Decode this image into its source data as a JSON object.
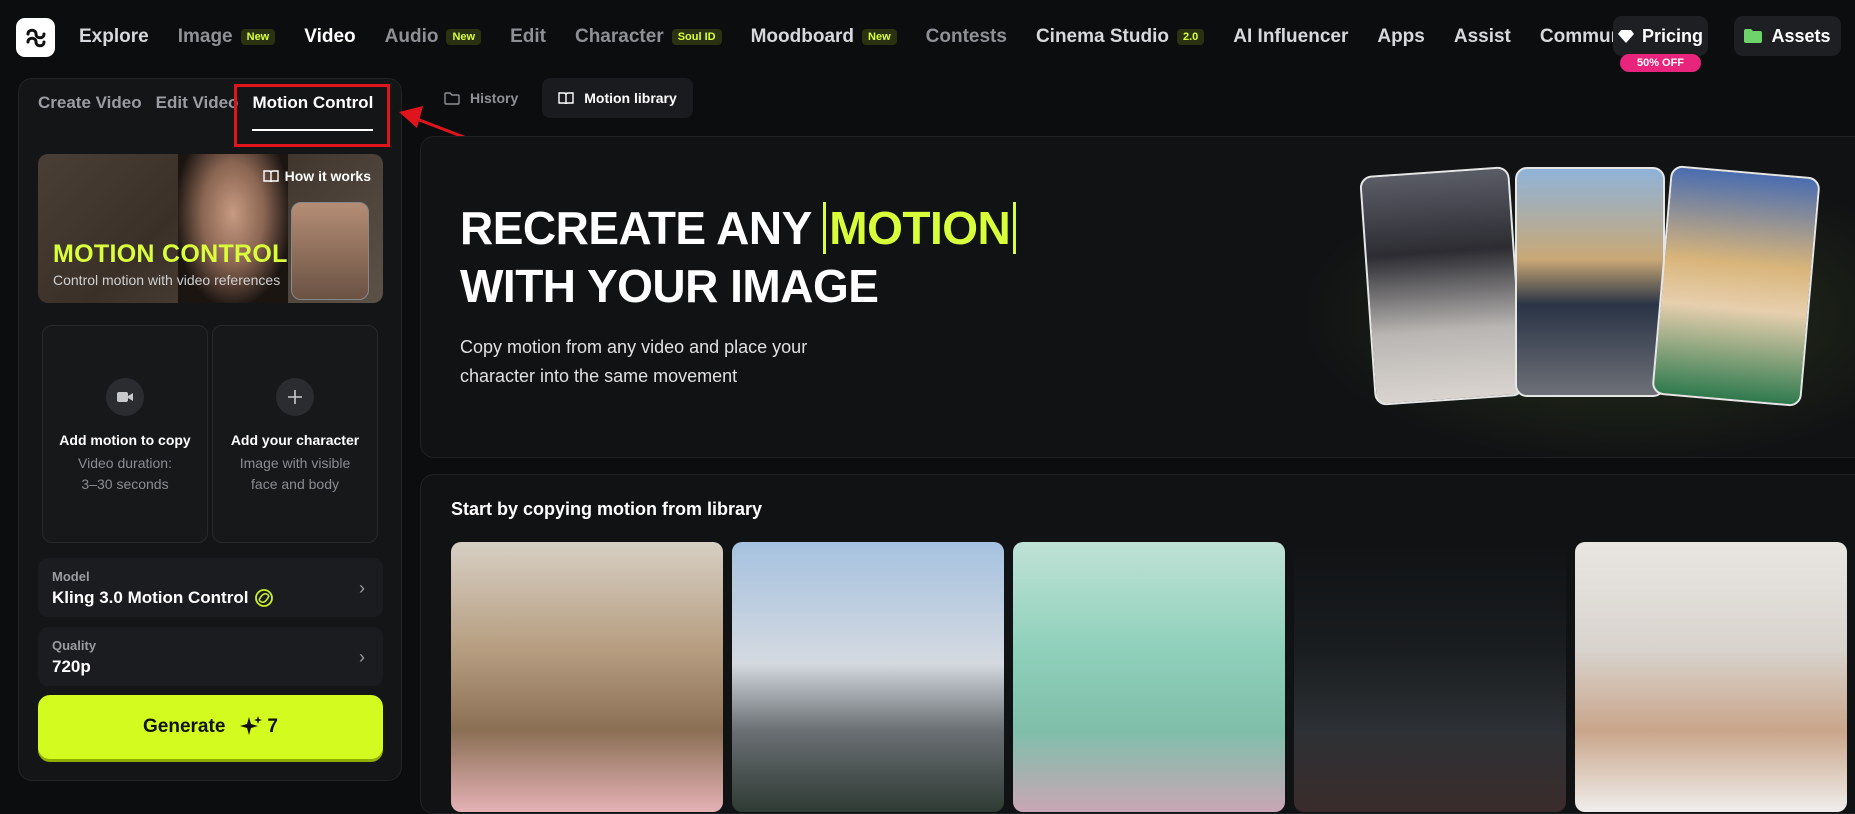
{
  "nav": {
    "items": [
      {
        "label": "Explore",
        "badge": ""
      },
      {
        "label": "Image",
        "badge": "New"
      },
      {
        "label": "Video",
        "badge": ""
      },
      {
        "label": "Audio",
        "badge": "New"
      },
      {
        "label": "Edit",
        "badge": ""
      },
      {
        "label": "Character",
        "badge": "Soul ID"
      },
      {
        "label": "Moodboard",
        "badge": "New"
      },
      {
        "label": "Contests",
        "badge": ""
      },
      {
        "label": "Cinema Studio",
        "badge": "2.0"
      },
      {
        "label": "AI Influencer",
        "badge": ""
      },
      {
        "label": "Apps",
        "badge": ""
      },
      {
        "label": "Assist",
        "badge": ""
      },
      {
        "label": "Community",
        "badge": ""
      }
    ],
    "pricing_label": "Pricing",
    "sale_badge": "50% OFF",
    "assets_label": "Assets"
  },
  "sidebar": {
    "tabs": [
      "Create Video",
      "Edit Video",
      "Motion Control"
    ],
    "hero": {
      "how_it_works": "How it works",
      "title": "MOTION CONTROL",
      "subtitle": "Control motion with video references"
    },
    "upload_motion": {
      "title": "Add motion to copy",
      "line1": "Video duration:",
      "line2": "3–30 seconds"
    },
    "upload_character": {
      "title": "Add your character",
      "line1": "Image with visible",
      "line2": "face and body"
    },
    "model": {
      "label": "Model",
      "value": "Kling 3.0 Motion Control"
    },
    "quality": {
      "label": "Quality",
      "value": "720p"
    },
    "generate": {
      "label": "Generate",
      "cost": "7"
    }
  },
  "subtabs": [
    "History",
    "Motion library"
  ],
  "banner": {
    "line1_pre": "RECREATE ANY ",
    "line1_highlight": "MOTION",
    "line2": "WITH YOUR IMAGE",
    "desc_line1": "Copy motion from any video and place your",
    "desc_line2": "character into the same movement"
  },
  "library": {
    "title": "Start by copying motion from library"
  },
  "colors": {
    "accent": "#d9ff3a",
    "generate": "#d4fb1f",
    "sale": "#e8247c",
    "highlight_box": "#e0141c"
  }
}
